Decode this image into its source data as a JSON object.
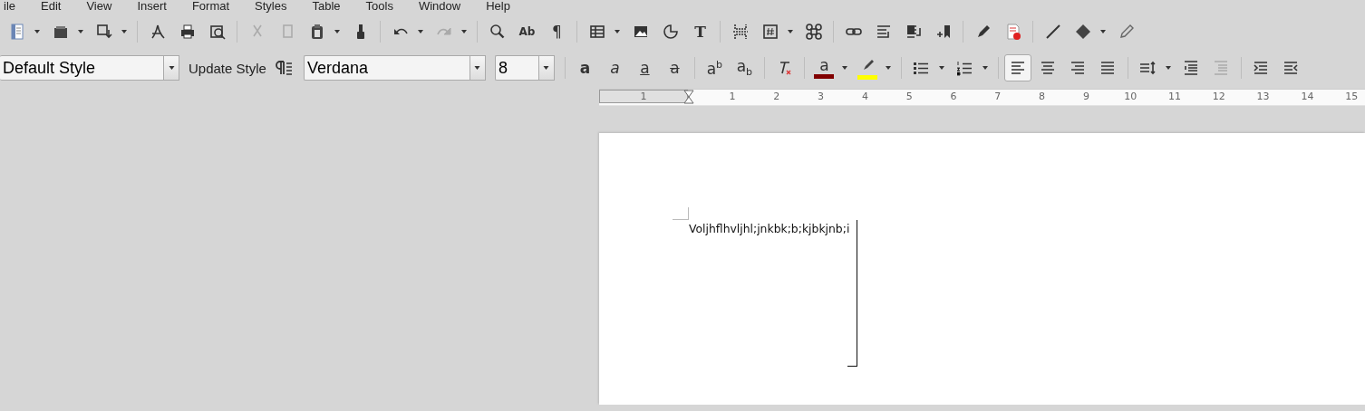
{
  "menu": [
    "ile",
    "Edit",
    "View",
    "Insert",
    "Format",
    "Styles",
    "Table",
    "Tools",
    "Window",
    "Help"
  ],
  "standard_toolbar": [
    {
      "kind": "button",
      "dropdown": true,
      "disabled": false
    },
    {
      "kind": "button",
      "dropdown": true,
      "disabled": false
    },
    {
      "kind": "button",
      "dropdown": true,
      "disabled": false
    },
    {
      "kind": "separator"
    },
    {
      "kind": "button",
      "dropdown": false,
      "disabled": false
    },
    {
      "kind": "button",
      "dropdown": false,
      "disabled": false
    },
    {
      "kind": "button",
      "dropdown": false,
      "disabled": false
    },
    {
      "kind": "separator"
    },
    {
      "kind": "button",
      "dropdown": false,
      "disabled": true
    },
    {
      "kind": "button",
      "dropdown": false,
      "disabled": true
    },
    {
      "kind": "button",
      "dropdown": true,
      "disabled": false
    },
    {
      "kind": "button",
      "dropdown": false,
      "disabled": false
    },
    {
      "kind": "separator"
    },
    {
      "kind": "button",
      "dropdown": true,
      "disabled": false
    },
    {
      "kind": "button",
      "dropdown": true,
      "disabled": true
    },
    {
      "kind": "separator"
    },
    {
      "kind": "button",
      "dropdown": false,
      "disabled": false
    },
    {
      "kind": "button",
      "dropdown": false,
      "disabled": false,
      "glyph": "Ab"
    },
    {
      "kind": "button",
      "dropdown": false,
      "disabled": false,
      "glyph": "¶"
    },
    {
      "kind": "separator"
    },
    {
      "kind": "button",
      "dropdown": true,
      "disabled": false
    },
    {
      "kind": "button",
      "dropdown": false,
      "disabled": false
    },
    {
      "kind": "button",
      "dropdown": false,
      "disabled": false
    },
    {
      "kind": "button",
      "dropdown": false,
      "disabled": false,
      "glyph": "T"
    },
    {
      "kind": "separator"
    },
    {
      "kind": "button",
      "dropdown": false,
      "disabled": false
    },
    {
      "kind": "button",
      "dropdown": true,
      "disabled": false
    },
    {
      "kind": "button",
      "dropdown": false,
      "disabled": false
    },
    {
      "kind": "separator"
    },
    {
      "kind": "button",
      "dropdown": false,
      "disabled": false
    },
    {
      "kind": "button",
      "dropdown": false,
      "disabled": false
    },
    {
      "kind": "button",
      "dropdown": false,
      "disabled": false
    },
    {
      "kind": "button",
      "dropdown": false,
      "disabled": false
    },
    {
      "kind": "separator"
    },
    {
      "kind": "button",
      "dropdown": false,
      "disabled": false
    },
    {
      "kind": "button",
      "dropdown": false,
      "disabled": false
    },
    {
      "kind": "separator"
    },
    {
      "kind": "button",
      "dropdown": false,
      "disabled": false
    },
    {
      "kind": "button",
      "dropdown": true,
      "disabled": false
    },
    {
      "kind": "button",
      "dropdown": false,
      "disabled": false
    }
  ],
  "formatting_toolbar": {
    "paragraph_style": "Default Style",
    "update_style": "Update Style",
    "font_name": "Verdana",
    "font_size": "8",
    "items": [
      {
        "kind": "separator"
      },
      {
        "kind": "button",
        "dropdown": false,
        "disabled": false,
        "glyph": "a"
      },
      {
        "kind": "button",
        "dropdown": false,
        "disabled": false,
        "glyph": "a"
      },
      {
        "kind": "button",
        "dropdown": false,
        "disabled": false,
        "glyph": "a"
      },
      {
        "kind": "button",
        "dropdown": false,
        "disabled": false,
        "glyph": "a"
      },
      {
        "kind": "separator"
      },
      {
        "kind": "button",
        "dropdown": false,
        "disabled": false,
        "glyph": "a$^{b}$"
      },
      {
        "kind": "button",
        "dropdown": false,
        "disabled": false,
        "glyph": "a$_{b}$"
      },
      {
        "kind": "separator"
      },
      {
        "kind": "button",
        "dropdown": false,
        "disabled": false
      },
      {
        "kind": "separator"
      },
      {
        "kind": "button",
        "dropdown": true,
        "disabled": false,
        "glyph": "a",
        "color": "#800000"
      },
      {
        "kind": "button",
        "dropdown": true,
        "disabled": false,
        "color": "#ffff00"
      },
      {
        "kind": "separator"
      },
      {
        "kind": "button",
        "dropdown": true,
        "disabled": false
      },
      {
        "kind": "button",
        "dropdown": true,
        "disabled": false
      },
      {
        "kind": "separator"
      },
      {
        "kind": "button",
        "dropdown": false,
        "disabled": false,
        "selected": true
      },
      {
        "kind": "button",
        "dropdown": false,
        "disabled": false,
        "selected": false
      },
      {
        "kind": "button",
        "dropdown": false,
        "disabled": false,
        "selected": false
      },
      {
        "kind": "button",
        "dropdown": false,
        "disabled": false,
        "selected": false
      },
      {
        "kind": "separator"
      },
      {
        "kind": "button",
        "dropdown": true,
        "disabled": false
      },
      {
        "kind": "button",
        "dropdown": false,
        "disabled": false
      },
      {
        "kind": "button",
        "dropdown": false,
        "disabled": true
      },
      {
        "kind": "separator"
      },
      {
        "kind": "button",
        "dropdown": false,
        "disabled": false
      },
      {
        "kind": "button",
        "dropdown": false,
        "disabled": false
      }
    ]
  },
  "ruler": {
    "labels": [
      "1",
      "1",
      "2",
      "3",
      "4",
      "5",
      "6",
      "7",
      "8",
      "9",
      "10",
      "11",
      "12",
      "13",
      "14",
      "15"
    ]
  },
  "document": {
    "text": "Voljhflhvljhl;jnkbk;b;kjbkjnb;i"
  }
}
